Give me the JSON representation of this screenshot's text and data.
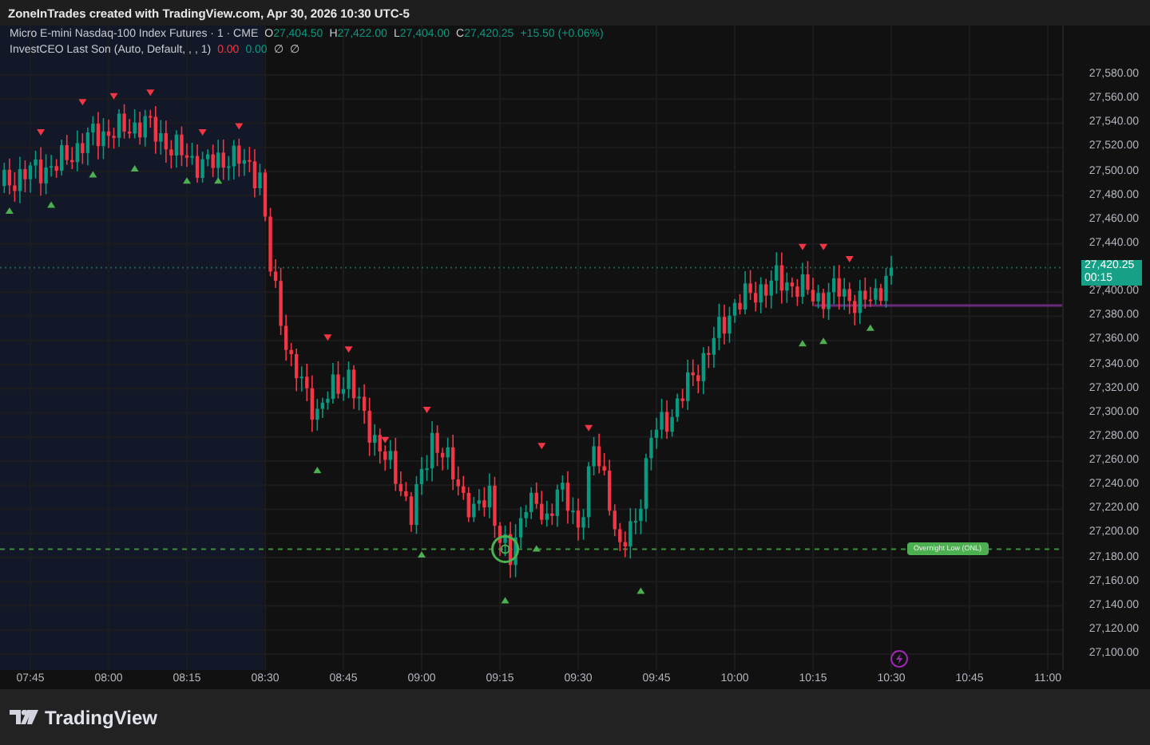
{
  "header": {
    "text": "ZoneInTrades created with TradingView.com, Apr 30, 2026 10:30 UTC-5"
  },
  "legend": {
    "symbol": "Micro E-mini Nasdaq-100 Index Futures · 1 · CME",
    "ohlc": [
      {
        "label": "O",
        "value": "27,404.50"
      },
      {
        "label": "H",
        "value": "27,422.00"
      },
      {
        "label": "L",
        "value": "27,404.00"
      },
      {
        "label": "C",
        "value": "27,420.25"
      }
    ],
    "change": "+15.50 (+0.06%)"
  },
  "indicator": {
    "name": "InvestCEO Last Son (Auto, Default, , , 1)",
    "values": [
      {
        "text": "0.00",
        "color": "#f23645"
      },
      {
        "text": "0.00",
        "color": "#089981"
      },
      {
        "text": "∅"
      },
      {
        "text": "∅"
      }
    ]
  },
  "price_axis": {
    "labels": [
      "27,580.00",
      "27,560.00",
      "27,540.00",
      "27,520.00",
      "27,500.00",
      "27,480.00",
      "27,460.00",
      "27,440.00",
      "27,400.00",
      "27,380.00",
      "27,360.00",
      "27,340.00",
      "27,320.00",
      "27,300.00",
      "27,280.00",
      "27,260.00",
      "27,240.00",
      "27,220.00",
      "27,200.00",
      "27,180.00",
      "27,160.00",
      "27,140.00",
      "27,120.00",
      "27,100.00"
    ],
    "current_price": {
      "price": "27,420.25",
      "countdown": "00:15"
    }
  },
  "time_axis": {
    "labels": [
      "07:45",
      "08:00",
      "08:15",
      "08:30",
      "08:45",
      "09:00",
      "09:15",
      "09:30",
      "09:45",
      "10:00",
      "10:15",
      "10:30",
      "10:45",
      "11:00"
    ]
  },
  "overnight_low": {
    "label": "Overnight Low (ONL)"
  },
  "footer": {
    "logo_text": "TradingView"
  }
}
